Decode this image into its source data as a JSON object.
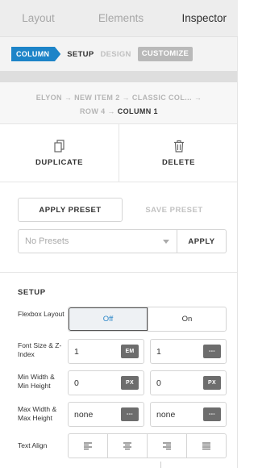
{
  "tabs": [
    {
      "label": "Layout",
      "active": false
    },
    {
      "label": "Elements",
      "active": false
    },
    {
      "label": "Inspector",
      "active": true
    }
  ],
  "mode_bar": {
    "column": "COLUMN",
    "setup": "SETUP",
    "design": "DESIGN",
    "customize": "CUSTOMIZE"
  },
  "path": {
    "line1": "ELYON → NEW ITEM 2 → CLASSIC COL... →",
    "line2_prefix": "ROW 4 →",
    "current": "COLUMN 1"
  },
  "actions": {
    "duplicate": "DUPLICATE",
    "delete": "DELETE"
  },
  "presets": {
    "apply_preset": "APPLY PRESET",
    "save_preset": "SAVE PRESET",
    "select_placeholder": "No Presets",
    "apply": "APPLY"
  },
  "setup": {
    "title": "SETUP",
    "flexbox_label": "Flexbox Layout",
    "flexbox_off": "Off",
    "flexbox_on": "On",
    "flexbox_value": "Off",
    "font_label": "Font Size & Z-Index",
    "font_size": "1",
    "font_unit": "EM",
    "z_index": "1",
    "z_unit": "---",
    "min_label": "Min Width & Min Height",
    "min_width": "0",
    "min_width_unit": "PX",
    "min_height": "0",
    "min_height_unit": "PX",
    "max_label": "Max Width & Max Height",
    "max_width": "none",
    "max_width_unit": "---",
    "max_height": "none",
    "max_height_unit": "---",
    "align_label": "Text Align",
    "align_options": [
      "left",
      "center",
      "right",
      "justify"
    ]
  },
  "colors": {
    "accent": "#1d84c8",
    "unit_badge": "#6d6d6d"
  }
}
